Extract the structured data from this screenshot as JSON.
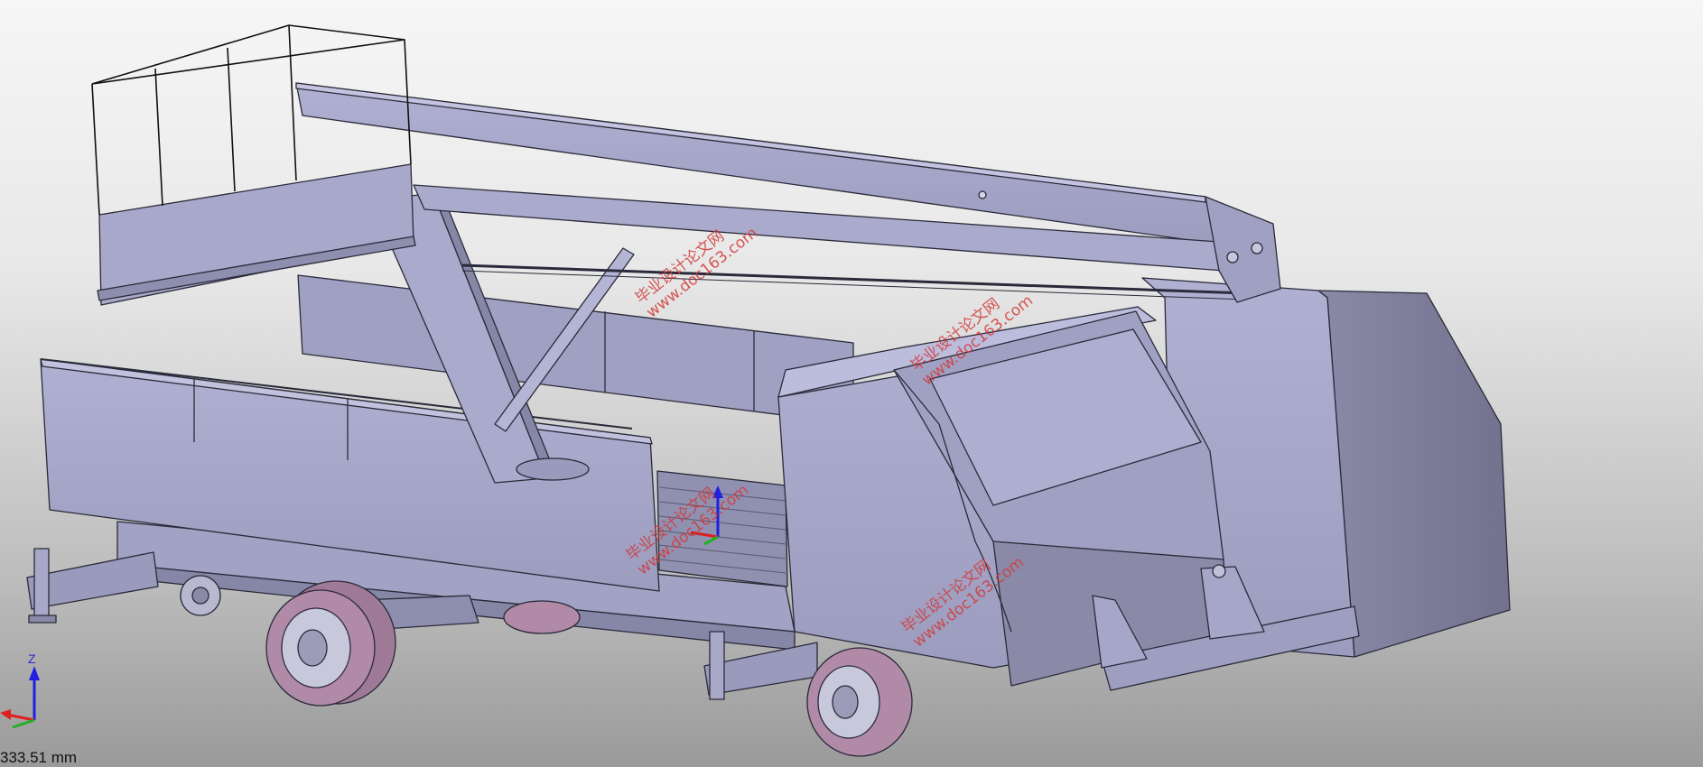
{
  "viewport": {
    "background_top": "#f6f6f6",
    "background_bottom": "#9a9a9a",
    "model_face_color": "#a6a6c8",
    "model_shadow_color": "#7a7a96",
    "model_edge_color": "#2a2a3a",
    "tire_color": "#b08aa6"
  },
  "watermarks": [
    {
      "line1": "毕业设计论文网",
      "line2": "www.doc163.com"
    },
    {
      "line1": "毕业设计论文网",
      "line2": "www.doc163.com"
    },
    {
      "line1": "毕业设计论文网",
      "line2": "www.doc163.com"
    },
    {
      "line1": "毕业设计论文网",
      "line2": "www.doc163.com"
    }
  ],
  "triad": {
    "z_label": "Z",
    "x_color": "#e02020",
    "y_color": "#20b020",
    "z_color": "#2020e0"
  },
  "scale": {
    "readout": "333.51 mm"
  }
}
